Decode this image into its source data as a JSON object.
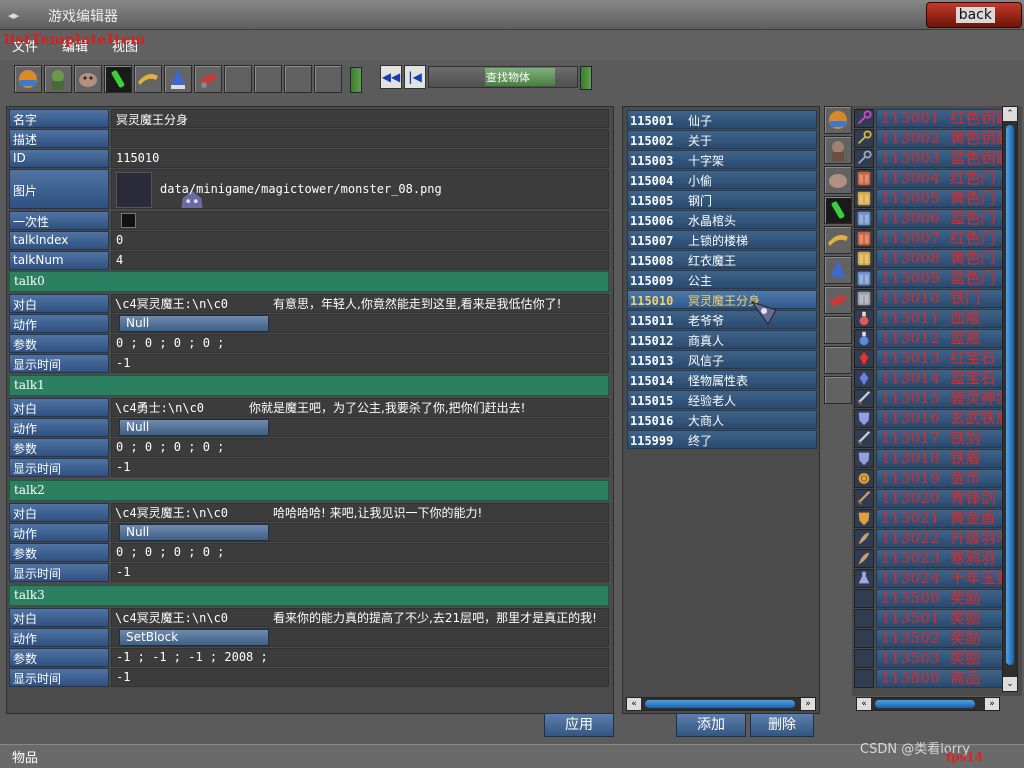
{
  "window": {
    "title": "游戏编辑器",
    "back_label": "back"
  },
  "overlay_text": "listTemplateItem",
  "menu": [
    "文件",
    "编辑",
    "视图"
  ],
  "toolbar": {
    "nav_label": "查找物体"
  },
  "form": {
    "name_label": "名字",
    "name_value": "冥灵魔王分身",
    "desc_label": "描述",
    "desc_value": "",
    "id_label": "ID",
    "id_value": "115010",
    "pic_label": "图片",
    "pic_value": "data/minigame/magictower/monster_08.png",
    "once_label": "一次性",
    "talkindex_label": "talkIndex",
    "talkindex_value": "0",
    "talknum_label": "talkNum",
    "talknum_value": "4"
  },
  "talks": [
    {
      "sep": "talk0",
      "dlg_label": "对白",
      "code": "\\c4冥灵魔王:\\n\\c0",
      "text": "有意思，年轻人,你竟然能走到这里,看来是我低估你了!",
      "action_label": "动作",
      "action": "Null",
      "param_label": "参数",
      "params": "0 ; 0 ; 0 ; 0 ;",
      "time_label": "显示时间",
      "time": "-1"
    },
    {
      "sep": "talk1",
      "dlg_label": "对白",
      "code": "\\c4勇士:\\n\\c0",
      "text": "你就是魔王吧，为了公主,我要杀了你,把你们赶出去!",
      "action_label": "动作",
      "action": "Null",
      "param_label": "参数",
      "params": "0 ; 0 ; 0 ; 0 ;",
      "time_label": "显示时间",
      "time": "-1"
    },
    {
      "sep": "talk2",
      "dlg_label": "对白",
      "code": "\\c4冥灵魔王:\\n\\c0",
      "text": "哈哈哈哈! 来吧,让我见识一下你的能力!",
      "action_label": "动作",
      "action": "Null",
      "param_label": "参数",
      "params": "0 ; 0 ; 0 ; 0 ;",
      "time_label": "显示时间",
      "time": "-1"
    },
    {
      "sep": "talk3",
      "dlg_label": "对白",
      "code": "\\c4冥灵魔王:\\n\\c0",
      "text": "看来你的能力真的提高了不少,去21层吧，那里才是真正的我!",
      "action_label": "动作",
      "action": "SetBlock",
      "param_label": "参数",
      "params": "-1 ; -1 ; -1 ; 2008 ;",
      "time_label": "显示时间",
      "time": "-1"
    }
  ],
  "buttons": {
    "apply": "应用",
    "add": "添加",
    "delete": "删除"
  },
  "npc_list": [
    {
      "id": "115001",
      "name": "仙子"
    },
    {
      "id": "115002",
      "name": "关于"
    },
    {
      "id": "115003",
      "name": "十字架"
    },
    {
      "id": "115004",
      "name": "小偷"
    },
    {
      "id": "115005",
      "name": "钢门"
    },
    {
      "id": "115006",
      "name": "水晶棺头"
    },
    {
      "id": "115007",
      "name": "上锁的楼梯"
    },
    {
      "id": "115008",
      "name": "红衣魔王"
    },
    {
      "id": "115009",
      "name": "公主"
    },
    {
      "id": "115010",
      "name": "冥灵魔王分身",
      "selected": true
    },
    {
      "id": "115011",
      "name": "老爷爷"
    },
    {
      "id": "115012",
      "name": "商真人"
    },
    {
      "id": "115013",
      "name": "风信子"
    },
    {
      "id": "115014",
      "name": "怪物属性表"
    },
    {
      "id": "115015",
      "name": "经验老人"
    },
    {
      "id": "115016",
      "name": "大商人"
    },
    {
      "id": "115999",
      "name": "终了"
    }
  ],
  "item_list": [
    {
      "id": "113001",
      "name": "红色钥匙",
      "icon": "key-icon",
      "color": "#c94ac9"
    },
    {
      "id": "113002",
      "name": "黄色钥匙",
      "icon": "key-icon",
      "color": "#d8b34a"
    },
    {
      "id": "113003",
      "name": "蓝色钥匙",
      "icon": "key-icon",
      "color": "#9aa8c0"
    },
    {
      "id": "113004",
      "name": "红色门",
      "icon": "door-icon",
      "color": "#d0603a"
    },
    {
      "id": "113005",
      "name": "黄色门",
      "icon": "door-icon",
      "color": "#d6a843"
    },
    {
      "id": "113006",
      "name": "蓝色门",
      "icon": "door-icon",
      "color": "#6f8fc8"
    },
    {
      "id": "113007",
      "name": "红色门",
      "icon": "door-icon",
      "color": "#d0603a"
    },
    {
      "id": "113008",
      "name": "黄色门",
      "icon": "door-icon",
      "color": "#d6a843"
    },
    {
      "id": "113009",
      "name": "蓝色门",
      "icon": "door-icon",
      "color": "#6f8fc8"
    },
    {
      "id": "113010",
      "name": "铁门",
      "icon": "door-icon",
      "color": "#9aa0a8"
    },
    {
      "id": "113011",
      "name": "血瓶",
      "icon": "potion-icon",
      "color": "#e05a5a"
    },
    {
      "id": "113012",
      "name": "蓝瓶",
      "icon": "potion-icon",
      "color": "#5a8ae0"
    },
    {
      "id": "113013",
      "name": "红宝石",
      "icon": "gem-icon",
      "color": "#e03030"
    },
    {
      "id": "113014",
      "name": "蓝宝石",
      "icon": "gem-icon",
      "color": "#6a7fe0"
    },
    {
      "id": "113015",
      "name": "碧灵神剑",
      "icon": "sword-icon",
      "color": "#c8d0e0"
    },
    {
      "id": "113016",
      "name": "玄武铁盾",
      "icon": "shield-icon",
      "color": "#8f9fe0"
    },
    {
      "id": "113017",
      "name": "铁剑",
      "icon": "sword-icon",
      "color": "#c8d0e0"
    },
    {
      "id": "113018",
      "name": "铁盾",
      "icon": "shield-icon",
      "color": "#8f9fe0"
    },
    {
      "id": "113019",
      "name": "金币",
      "icon": "coin-icon",
      "color": "#e0a040"
    },
    {
      "id": "113020",
      "name": "青锋剑",
      "icon": "sword-icon",
      "color": "#c8a070"
    },
    {
      "id": "113021",
      "name": "黄金盾",
      "icon": "shield-icon",
      "color": "#e0a040"
    },
    {
      "id": "113022",
      "name": "升级羽毛",
      "icon": "feather-icon",
      "color": "#c8a070"
    },
    {
      "id": "113023",
      "name": "寒鸦羽",
      "icon": "feather-icon",
      "color": "#c8a070"
    },
    {
      "id": "113024",
      "name": "千年玉露",
      "icon": "flask-icon",
      "color": "#a0a8e0"
    },
    {
      "id": "113500",
      "name": "奖励",
      "icon": "",
      "color": ""
    },
    {
      "id": "113501",
      "name": "奖励",
      "icon": "",
      "color": ""
    },
    {
      "id": "113502",
      "name": "奖励",
      "icon": "",
      "color": ""
    },
    {
      "id": "113503",
      "name": "奖励",
      "icon": "",
      "color": ""
    },
    {
      "id": "113800",
      "name": "商品",
      "icon": "",
      "color": ""
    }
  ],
  "status": {
    "text": "物品",
    "watermark": "CSDN @类看lorry",
    "fps": "fps14"
  }
}
